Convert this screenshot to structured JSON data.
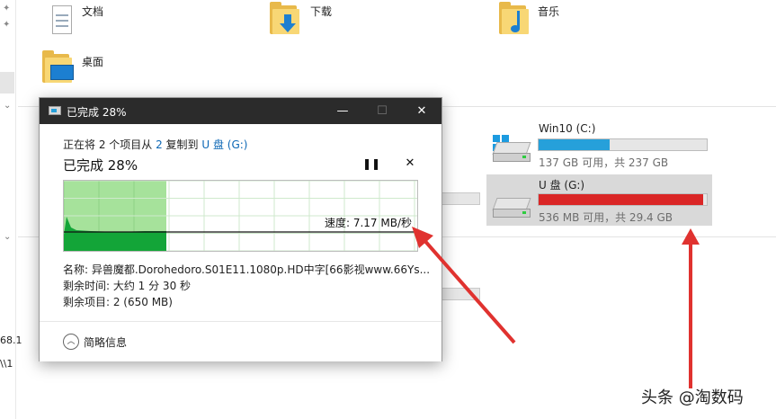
{
  "explorer": {
    "folders": [
      {
        "name": "文档",
        "icon": "documents-folder-icon"
      },
      {
        "name": "下载",
        "icon": "downloads-folder-icon"
      },
      {
        "name": "音乐",
        "icon": "music-folder-icon"
      },
      {
        "name": "桌面",
        "icon": "desktop-folder-icon"
      }
    ],
    "drives": [
      {
        "name": "Win10 (C:)",
        "space": "137 GB 可用，共 237 GB",
        "used_fraction": 0.42,
        "bar_color": "#26a0da"
      },
      {
        "name": "U 盘 (G:)",
        "space": "536 MB 可用，共 29.4 GB",
        "used_fraction": 0.98,
        "bar_color": "#da2626"
      }
    ],
    "left_text_1": "68.1",
    "left_text_2": "\\\\1"
  },
  "dialog": {
    "title": "已完成 28%",
    "line1_prefix": "正在将 2 个项目从 ",
    "line1_source": "2",
    "line1_mid": " 复制到 ",
    "line1_dest": "U 盘 (G:)",
    "status": "已完成 28%",
    "progress_fraction": 0.28,
    "speed": "速度: 7.17 MB/秒",
    "name_line": "名称: 异兽魔都.Dorohedoro.S01E11.1080p.HD中字[66影视www.66Ys...",
    "time_line": "剩余时间: 大约 1 分 30 秒",
    "items_line": "剩余项目: 2 (650 MB)",
    "details_label": "简略信息",
    "minimize_glyph": "—",
    "maximize_glyph": "☐",
    "close_glyph": "✕",
    "pause_glyph": "❚❚",
    "cancel_glyph": "✕",
    "details_glyph": "︿"
  },
  "colors": {
    "graph_fill": "#a6e29b",
    "graph_dark": "#13a538",
    "arrow": "#e0322f"
  },
  "watermark": "头条 @淘数码"
}
